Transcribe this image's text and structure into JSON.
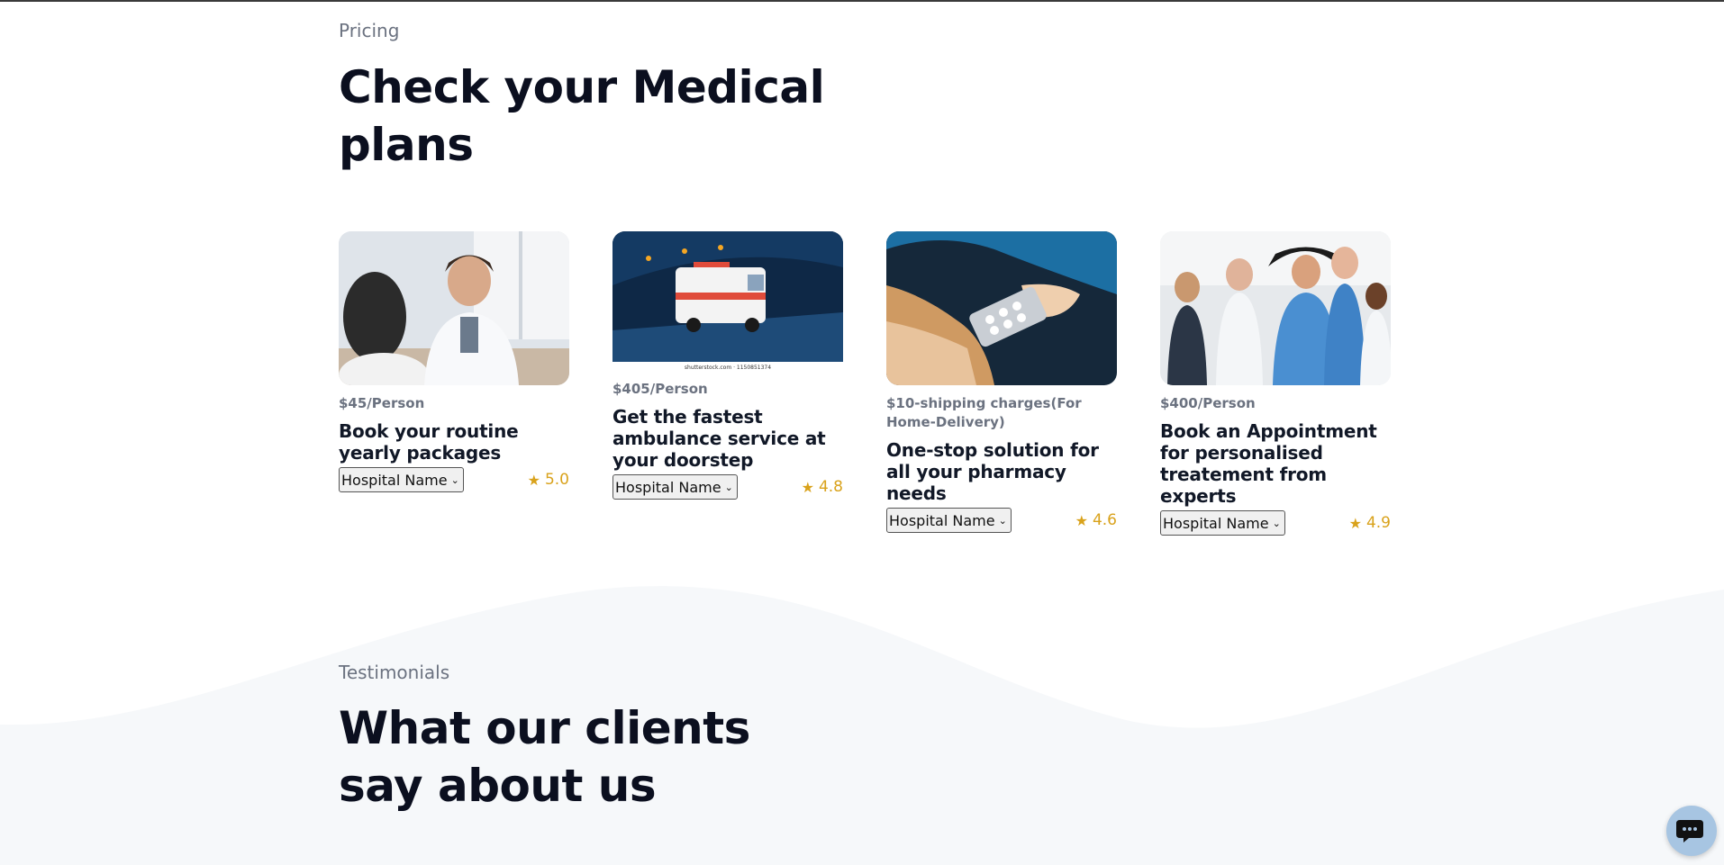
{
  "pricing": {
    "eyebrow": "Pricing",
    "heading_line1": "Check your Medical",
    "heading_line2": "plans"
  },
  "cards": [
    {
      "price": "$45/Person",
      "title": "Book your routine yearly packages",
      "select": "Hospital Name",
      "rating": "5.0",
      "image_icon": "doctor-consultation-photo"
    },
    {
      "price": "$405/Person",
      "title": "Get the fastest ambulance service at your doorstep",
      "select": "Hospital Name",
      "rating": "4.8",
      "image_icon": "ambulance-photo",
      "image_caption": "shutterstock.com · 1150851374"
    },
    {
      "price": "$10-shipping charges(For Home-Delivery)",
      "title": "One-stop solution for all your pharmacy needs",
      "select": "Hospital Name",
      "rating": "4.6",
      "image_icon": "pills-handover-photo"
    },
    {
      "price": "$400/Person",
      "title": "Book an Appointment for personalised treatement from experts",
      "select": "Hospital Name",
      "rating": "4.9",
      "image_icon": "medical-team-photo"
    }
  ],
  "testimonials": {
    "eyebrow": "Testimonials",
    "heading_line1": "What our clients",
    "heading_line2": "say about us"
  },
  "colors": {
    "accent_star": "#d9a21b",
    "heading": "#0b0f1f",
    "muted": "#6b7280",
    "wave": "#f6f8fa"
  },
  "icons": {
    "rating": "star-icon",
    "dropdown": "chevron-down-icon",
    "chat": "chat-icon"
  }
}
